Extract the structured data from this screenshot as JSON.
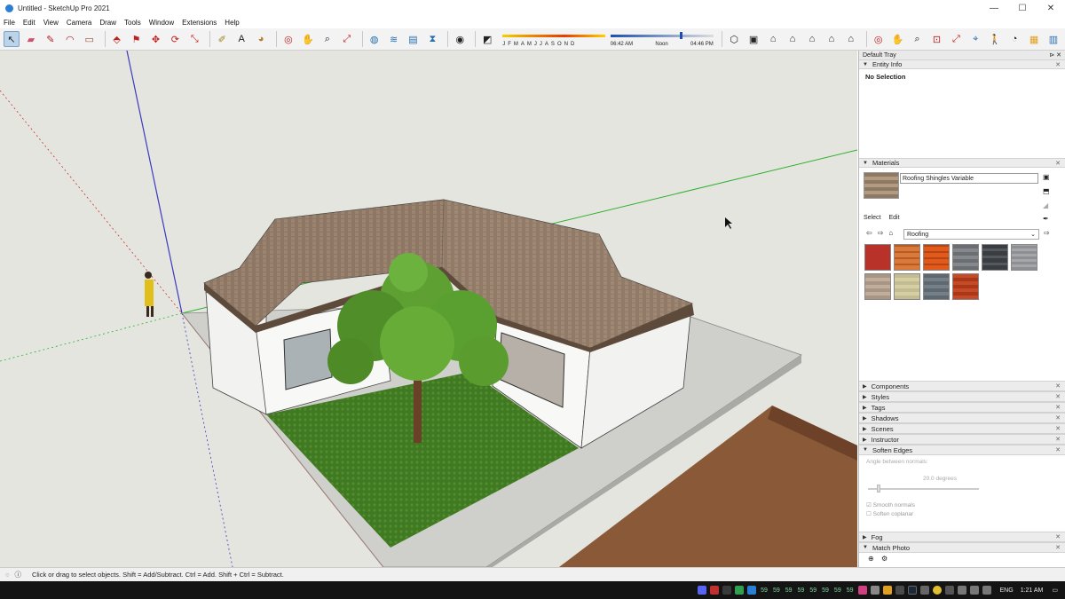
{
  "window": {
    "title": "Untitled - SketchUp Pro 2021",
    "minimize": "—",
    "maximize": "☐",
    "close": "✕"
  },
  "menu": [
    "File",
    "Edit",
    "View",
    "Camera",
    "Draw",
    "Tools",
    "Window",
    "Extensions",
    "Help"
  ],
  "shadows": {
    "months": [
      "J",
      "F",
      "M",
      "A",
      "M",
      "J",
      "J",
      "A",
      "S",
      "O",
      "N",
      "D"
    ],
    "time_start": "06:42 AM",
    "time_mid": "Noon",
    "time_end": "04:46 PM",
    "time_fraction": 0.68
  },
  "tray": {
    "title": "Default Tray",
    "entity_info": {
      "label": "Entity Info",
      "value": "No Selection"
    },
    "materials": {
      "label": "Materials",
      "current": "Roofing Shingles Variable",
      "tab_select": "Select",
      "tab_edit": "Edit",
      "collection": "Roofing",
      "swatch_colors": [
        "#b8322a",
        "#d97a3a",
        "#e05a1c",
        "#6b6e72",
        "#3a3d42",
        "#8d8f93",
        "#a89584",
        "#c4bc91",
        "#5d6870",
        "#c64a28"
      ]
    },
    "panels": [
      "Components",
      "Styles",
      "Tags",
      "Shadows",
      "Scenes",
      "Instructor"
    ],
    "soften_edges": {
      "label": "Soften Edges",
      "angle_label": "Angle between normals:",
      "angle_value": "20.0  degrees",
      "smooth": "Smooth normals",
      "coplanar": "Soften coplanar"
    },
    "bottom_panels": [
      "Fog",
      "Match Photo"
    ]
  },
  "status": {
    "message": "Click or drag to select objects. Shift = Add/Subtract. Ctrl = Add. Shift + Ctrl = Subtract."
  },
  "taskbar": {
    "lang": "ENG",
    "time": "1:21 AM",
    "badge": "59"
  }
}
